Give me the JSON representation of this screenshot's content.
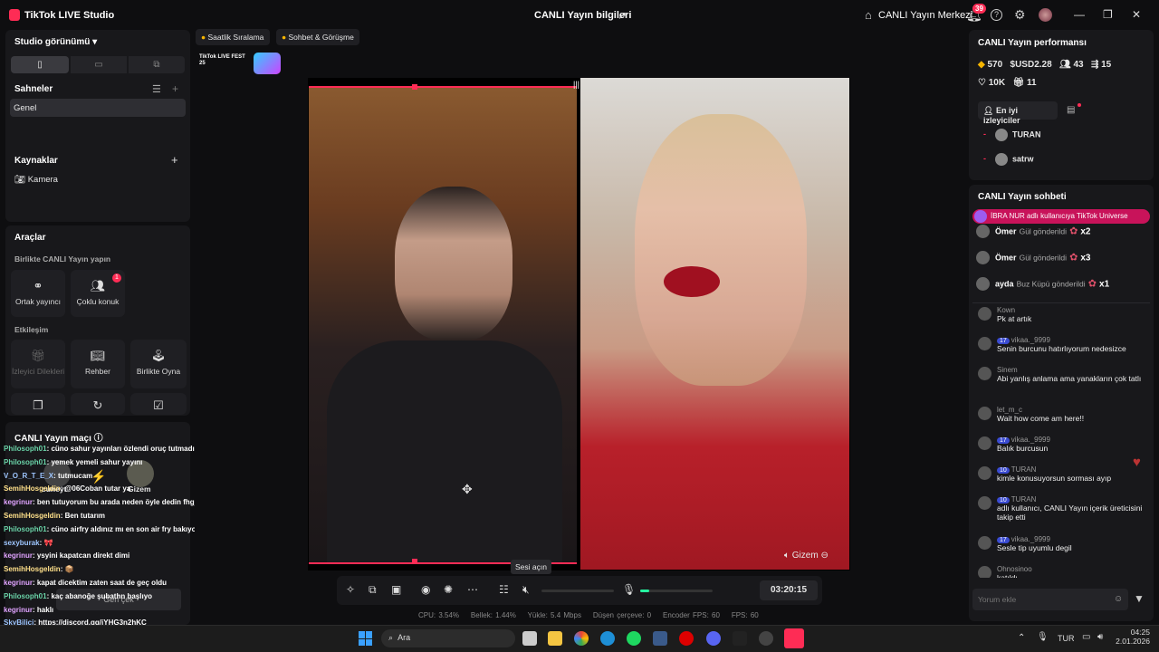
{
  "titlebar": {
    "app_name": "TikTok LIVE Studio",
    "center_title": "CANLI Yayın bilgileri",
    "live_center": "CANLI Yayın Merkezi",
    "notif_count": "39"
  },
  "left": {
    "studio_view": "Studio görünümü",
    "scenes_title": "Sahneler",
    "scene_item": "Genel",
    "sources_title": "Kaynaklar",
    "source_item": "Kamera",
    "tools_title": "Araçlar",
    "together_title": "Birlikte CANLI Yayın yapın",
    "tool_cohost": "Ortak yayıncı",
    "tool_multi_guest": "Çoklu konuk",
    "multi_guest_badge": "1",
    "interaction_title": "Etkileşim",
    "tool_viewer_wishes": "İzleyici Dilekleri",
    "tool_guide": "Rehber",
    "tool_play_together": "Birlikte Oyna",
    "match_title": "CANLI Yayın maçı",
    "match_left_name": "cuneyt",
    "match_right_name": "Gizem",
    "match_btn": "Geri çek"
  },
  "chat_left": [
    {
      "user": "Philosoph01",
      "msg": ": cüno sahur yayınları özlendi oruç tutmadığın halde 😊",
      "cls": "u"
    },
    {
      "user": "Philosoph01",
      "msg": ": yemek yemeli sahur yayını",
      "cls": "u"
    },
    {
      "user": "V_O_R_T_E_X",
      "msg": ": tutmucam",
      "cls": "u4"
    },
    {
      "user": "SemihHosgeldin",
      "msg": ": @06Coban tutar ya",
      "cls": "u3"
    },
    {
      "user": "kegrinur",
      "msg": ": ben tutuyorum bu arada neden öyle dedin fhgjvjv",
      "cls": "u2"
    },
    {
      "user": "SemihHosgeldin",
      "msg": ": Ben tutarım",
      "cls": "u3"
    },
    {
      "user": "Philosoph01",
      "msg": ": cüno airfry aldınız mı en son air fry bakıyodunux",
      "cls": "u"
    },
    {
      "user": "sexyburak",
      "msg": ": 🎀",
      "cls": "u4"
    },
    {
      "user": "kegrinur",
      "msg": ": ysyini kapatcan direkt dimi",
      "cls": "u2"
    },
    {
      "user": "SemihHosgeldin",
      "msg": ": 📦",
      "cls": "u3"
    },
    {
      "user": "kegrinur",
      "msg": ": kapat dicektim zaten saat de geç oldu",
      "cls": "u2"
    },
    {
      "user": "Philosoph01",
      "msg": ": kaç abanoğe şubathn başlıyo",
      "cls": "u"
    },
    {
      "user": "kegrinur",
      "msg": ": haklı",
      "cls": "u2"
    },
    {
      "user": "SkyBilici",
      "msg": ": https://discord.gg/jYHG3n2hKC",
      "cls": "u4"
    },
    {
      "user": "kegrinur",
      "msg": ": insan bi siz niye uyumuyorsunuz diye sorar",
      "cls": "u2"
    }
  ],
  "top_tabs": {
    "hourly_rank": "Saatlik Sıralama",
    "chat_meet": "Sohbet & Görüşme",
    "fest_logo": "TikTok LIVE FEST 25"
  },
  "preview": {
    "guest_name": "Gizem",
    "tooltip": "Sesi açın",
    "timer": "03:20:15"
  },
  "stats": {
    "cpu": "CPU: 3.54%",
    "mem": "Bellek: 1.44%",
    "upload": "Yükle: 5.4 Mbps",
    "drop": "Düşen çerçeve: 0",
    "enc": "Encoder FPS: 60",
    "fps": "FPS: 60"
  },
  "right": {
    "perf_title": "CANLI Yayın performansı",
    "coins": "570",
    "usd": "USD2.28",
    "viewers": "43",
    "shares": "15",
    "likes": "10K",
    "gifts": "11",
    "top_viewers_tab": "En iyi izleyiciler",
    "top_viewers": [
      {
        "name": "TURAN"
      },
      {
        "name": "satrw"
      }
    ],
    "chat_title": "CANLI Yayın sohbeti",
    "universe_banner": "İBRA NUR adlı kullanıcıya TikTok Universe",
    "gifts_list": [
      {
        "name": "Ömer",
        "text": "Gül gönderildi",
        "count": "x2"
      },
      {
        "name": "Ömer",
        "text": "Gül gönderildi",
        "count": "x3"
      },
      {
        "name": "ayda",
        "text": "Buz Küpü gönderildi",
        "count": "x1"
      }
    ],
    "messages": [
      {
        "name": "Kown",
        "lvl": "",
        "msg": "Pk at artık"
      },
      {
        "name": "vikaa._9999",
        "lvl": "17",
        "msg": "Senin burcunu hatırlıyorum nedesizce"
      },
      {
        "name": "Sinem",
        "lvl": "",
        "msg": "Abi yanlış anlama ama yanakların çok tatlı"
      },
      {
        "name": "let_m_c",
        "lvl": "",
        "msg": "Wait how come am here!!"
      },
      {
        "name": "vikaa._9999",
        "lvl": "17",
        "msg": "Balık burcusun"
      },
      {
        "name": "TURAN",
        "lvl": "10",
        "msg": "kimle konusuyorsun sorması ayıp"
      },
      {
        "name": "TURAN",
        "lvl": "10",
        "msg": "adlı kullanıcı, CANLI Yayın içerik üreticisini takip etti"
      },
      {
        "name": "vikaa._9999",
        "lvl": "17",
        "msg": "Sesle tip uyumlu degil"
      },
      {
        "name": "Ohnosinoo",
        "lvl": "",
        "msg": "katıldı"
      }
    ],
    "comment_placeholder": "Yorum ekle"
  },
  "taskbar": {
    "search": "Ara",
    "lang": "TUR",
    "time": "04:25",
    "date": "2.01.2026"
  },
  "colors": {
    "accent": "#fe2c55",
    "panel": "#18181b",
    "bg": "#0e0e10"
  }
}
